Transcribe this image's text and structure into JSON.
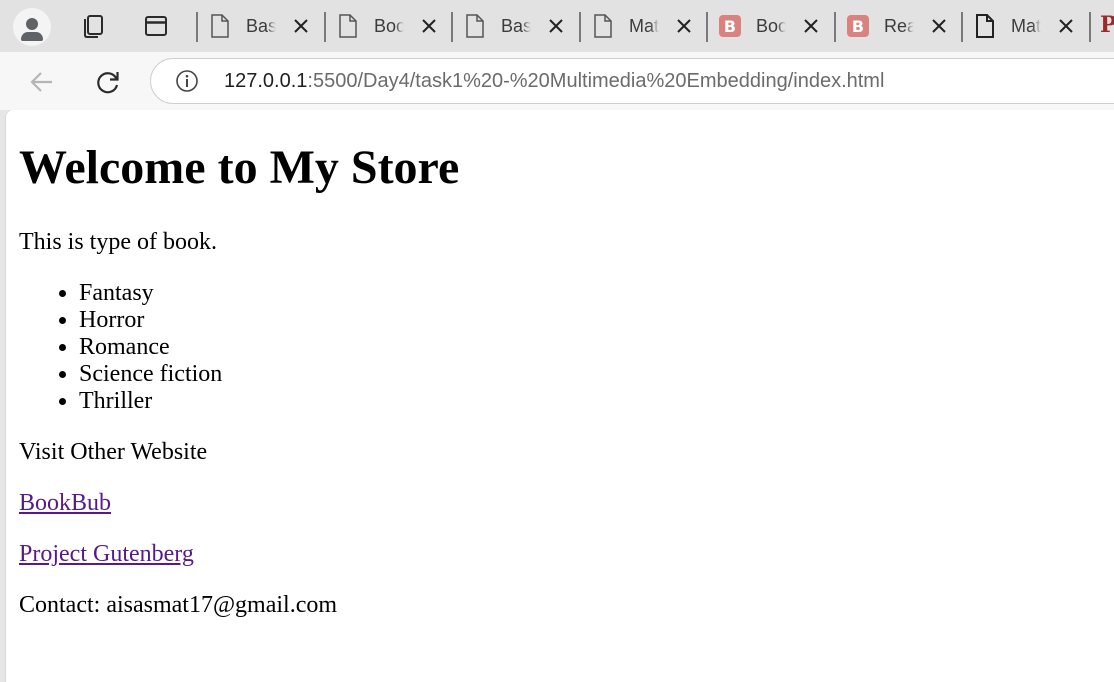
{
  "browser": {
    "tabs": [
      {
        "title": "Basic Html",
        "icon": "document-icon"
      },
      {
        "title": "Book Store",
        "icon": "document-icon"
      },
      {
        "title": "Basic Css",
        "icon": "document-icon"
      },
      {
        "title": "Mat/",
        "icon": "document-icon"
      },
      {
        "title": "Book",
        "icon": "b-favicon-icon"
      },
      {
        "title": "Read",
        "icon": "b-favicon-icon"
      },
      {
        "title": "Mat/",
        "icon": "document-icon"
      }
    ],
    "favicon_letter": "B",
    "partial_tab_letter": "P",
    "address": {
      "host": "127.0.0.1",
      "rest": ":5500/Day4/task1%20-%20Multimedia%20Embedding/index.html"
    }
  },
  "page": {
    "heading": "Welcome to My Store",
    "intro": "This is type of book.",
    "genres": [
      "Fantasy",
      "Horror",
      "Romance",
      "Science fiction",
      "Thriller"
    ],
    "visit_label": "Visit Other Website",
    "links": [
      {
        "label": "BookBub"
      },
      {
        "label": "Project Gutenberg"
      }
    ],
    "contact": "Contact: aisasmat17@gmail.com"
  },
  "colors": {
    "visited_link": "#551a8b",
    "tab_strip": "#e2e2e2",
    "toolbar": "#f7f7f7",
    "b_favicon": "#d9827f"
  }
}
